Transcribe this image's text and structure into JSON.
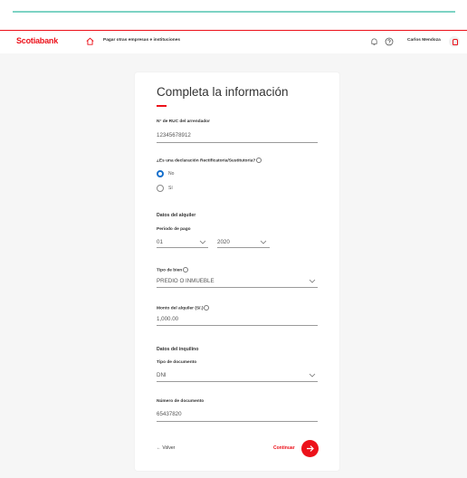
{
  "header": {
    "brand": "Scotiabank",
    "nav_link": "Pagar otras empresas e instituciones",
    "user_name": "Carlos Mendoza"
  },
  "form": {
    "title": "Completa la información",
    "ruc": {
      "label": "N° de RUC del arrendador",
      "value": "12345678912"
    },
    "declaration": {
      "question": "¿Es una declaración Rectificatoria/Sustitutoria?",
      "options": [
        {
          "label": "No",
          "selected": true
        },
        {
          "label": "Sí",
          "selected": false
        }
      ]
    },
    "rental_section": "Datos del alquiler",
    "period": {
      "label": "Periodo de pago",
      "month": "01",
      "year": "2020"
    },
    "asset_type": {
      "label": "Tipo de bien",
      "value": "PREDIO O INMUEBLE"
    },
    "amount": {
      "label": "Monto del alquiler (S/.)",
      "value": "1,000.00"
    },
    "tenant_section": "Datos del inquilino",
    "doc_type": {
      "label": "Tipo de documento",
      "value": "DNI"
    },
    "doc_number": {
      "label": "Número de documento",
      "value": "65437820"
    },
    "back_label": "Volver",
    "continue_label": "Continuar"
  },
  "colors": {
    "brand_red": "#ec111a",
    "radio_blue": "#1670cc",
    "accent_teal": "#7dd3c4"
  }
}
